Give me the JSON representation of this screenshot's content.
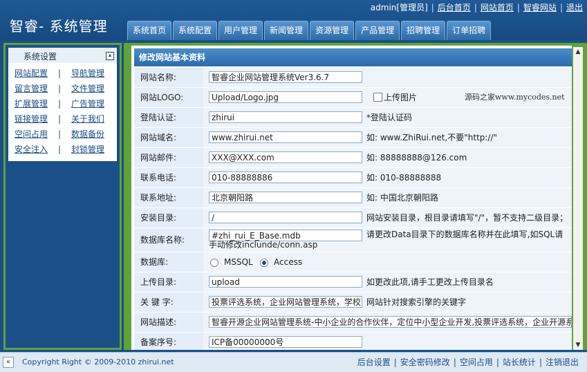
{
  "header": {
    "title": "智睿- 系统管理",
    "user": "admin[管理员]",
    "links": [
      "后台首页",
      "网站首页",
      "智睿网站",
      "退出"
    ],
    "tabs": [
      "系统首页",
      "系统配置",
      "用户管理",
      "新闻管理",
      "资源管理",
      "产品管理",
      "招聘管理",
      "订单招聘"
    ]
  },
  "sidebar": {
    "title": "系统设置",
    "collapse": "▴",
    "rows": [
      [
        "网站配置",
        "导航管理"
      ],
      [
        "留言管理",
        "文件管理"
      ],
      [
        "扩展管理",
        "广告管理"
      ],
      [
        "链接管理",
        "关于我们"
      ],
      [
        "空间占用",
        "数据备份"
      ],
      [
        "安全注入",
        "封锁管理"
      ]
    ],
    "sep": "|"
  },
  "panel": {
    "title": "修改网站基本资料",
    "fields": {
      "name": {
        "label": "网站名称:",
        "value": "智睿企业网站管理系统Ver3.6.7"
      },
      "logo": {
        "label": "网站LOGO:",
        "value": "Upload/Logo.jpg",
        "upload": "上传图片",
        "watermark": "源码之家www.mycodes.net"
      },
      "auth": {
        "label": "登陆认证:",
        "value": "zhirui",
        "hint": "*登陆认证码"
      },
      "domain": {
        "label": "网站域名:",
        "value": "www.zhirui.net",
        "hint": "如: www.ZhiRui.net,不要\"http://\""
      },
      "email": {
        "label": "网站邮件:",
        "value": "XXX@XXX.com",
        "hint": "如: 88888888@126.com"
      },
      "phone": {
        "label": "联系电话:",
        "value": "010-88888886",
        "hint": "如: 010-88888888"
      },
      "address": {
        "label": "联系地址:",
        "value": "北京朝阳路",
        "hint": "如: 中国北京朝阳路"
      },
      "install": {
        "label": "安装目录:",
        "value": "/",
        "hint": "网站安装目录，根目录请填写\"/\"，暂不支持二级目录；"
      },
      "dbname": {
        "label": "数据库名称:",
        "value": "#zhi_rui_E_Base.mdb",
        "hint": "请更改Data目录下的数据库名称并在此填写,如SQL请手动修改inclunde/conn.asp"
      },
      "db": {
        "label": "数据库:",
        "opt1": "MSSQL",
        "opt2": "Access",
        "selected": "Access"
      },
      "upload": {
        "label": "上传目录:",
        "value": "upload",
        "hint": "如更改此项,请手工更改上传目录名"
      },
      "keywords": {
        "label": "关 键 字:",
        "value": "投票评选系统，企业网站管理系统，学校网站",
        "hint": "网站针对搜索引擎的关键字"
      },
      "desc": {
        "label": "网站描述:",
        "value": "智睿开源企业网站管理系统-中小企业的合作伙伴，定位中小型企业开发,投票评选系统，企业开源系统"
      },
      "icp": {
        "label": "备案序号:",
        "value": "ICP备00000000号"
      }
    }
  },
  "footer": {
    "copyright": "Copyright Right © 2009-2010 zhirui.net",
    "toggle": "«",
    "links": [
      "后台设置",
      "安全密码修改",
      "空间占用",
      "站长统计",
      "注销退出"
    ]
  },
  "colors": {
    "primary": "#1a4e86",
    "accent": "#5fa33a",
    "tab": "#2b6aa8"
  }
}
